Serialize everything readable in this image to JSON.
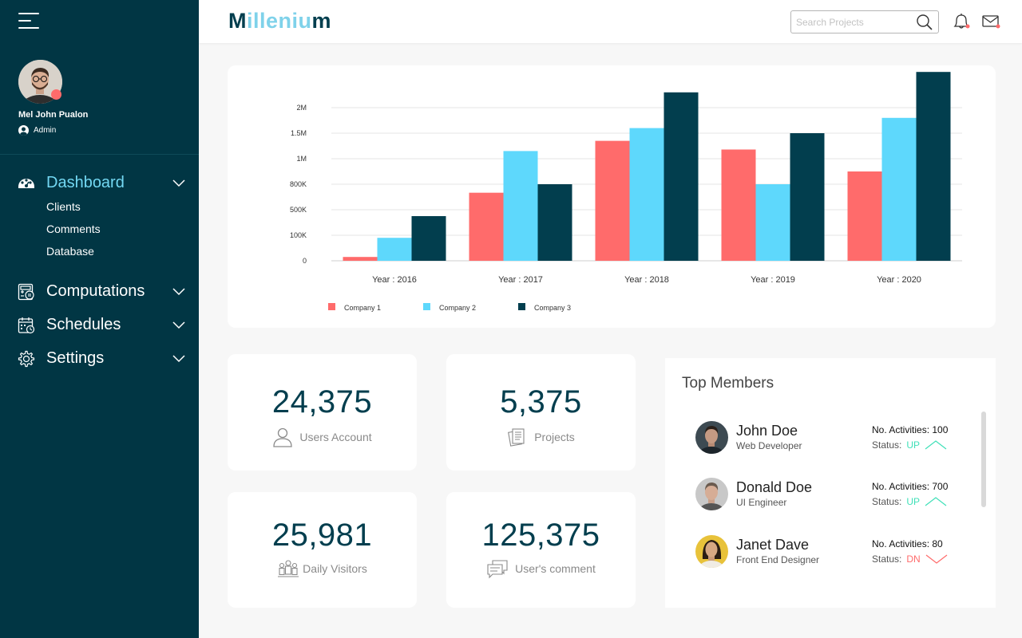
{
  "sidebar": {
    "user": {
      "name": "Mel John Pualon",
      "role": "Admin"
    },
    "nav": [
      {
        "label": "Dashboard",
        "icon": "dashboard-icon",
        "active": true,
        "children": [
          {
            "label": "Clients"
          },
          {
            "label": "Comments"
          },
          {
            "label": "Database"
          }
        ]
      },
      {
        "label": "Computations",
        "icon": "calculator-icon"
      },
      {
        "label": "Schedules",
        "icon": "calendar-icon"
      },
      {
        "label": "Settings",
        "icon": "gear-icon"
      }
    ]
  },
  "header": {
    "logo": {
      "part1": "M",
      "part2": "illeniu",
      "part3": "m"
    },
    "search_placeholder": "Search Projects"
  },
  "stats": [
    {
      "value": "24,375",
      "label": "Users Account",
      "icon": "user-icon"
    },
    {
      "value": "5,375",
      "label": "Projects",
      "icon": "documents-icon"
    },
    {
      "value": "25,981",
      "label": "Daily Visitors",
      "icon": "crowd-icon"
    },
    {
      "value": "125,375",
      "label": "User's comment",
      "icon": "comment-icon"
    }
  ],
  "members": {
    "title": "Top Members",
    "list": [
      {
        "name": "John Doe",
        "job": "Web Developer",
        "activities": "No. Activities: 100",
        "status_label": "Status:",
        "status": "UP"
      },
      {
        "name": "Donald Doe",
        "job": "UI Engineer",
        "activities": "No. Activities: 700",
        "status_label": "Status:",
        "status": "UP"
      },
      {
        "name": "Janet Dave",
        "job": "Front End Designer",
        "activities": "No. Activities: 80",
        "status_label": "Status:",
        "status": "DN"
      }
    ]
  },
  "colors": {
    "sidebar": "#013644",
    "company1": "#ff6b6b",
    "company2": "#5ed8fc",
    "company3": "#023e4e",
    "up": "#3fe0b8",
    "down": "#ff6b6b"
  },
  "chart_data": {
    "type": "bar",
    "categories": [
      "Year : 2016",
      "Year : 2017",
      "Year : 2018",
      "Year : 2019",
      "Year : 2020"
    ],
    "y_ticks": [
      "0",
      "100K",
      "500K",
      "800K",
      "1M",
      "1.5M",
      "2M"
    ],
    "series": [
      {
        "name": "Company 1",
        "color": "#ff6b6b",
        "values": [
          15000,
          700000,
          1350000,
          1180000,
          900000
        ]
      },
      {
        "name": "Company 2",
        "color": "#5ed8fc",
        "values": [
          90000,
          1150000,
          1600000,
          800000,
          1800000
        ]
      },
      {
        "name": "Company 3",
        "color": "#023e4e",
        "values": [
          400000,
          800000,
          2300000,
          1500000,
          2700000
        ]
      }
    ],
    "legend": "bottom-left",
    "grid": true
  }
}
